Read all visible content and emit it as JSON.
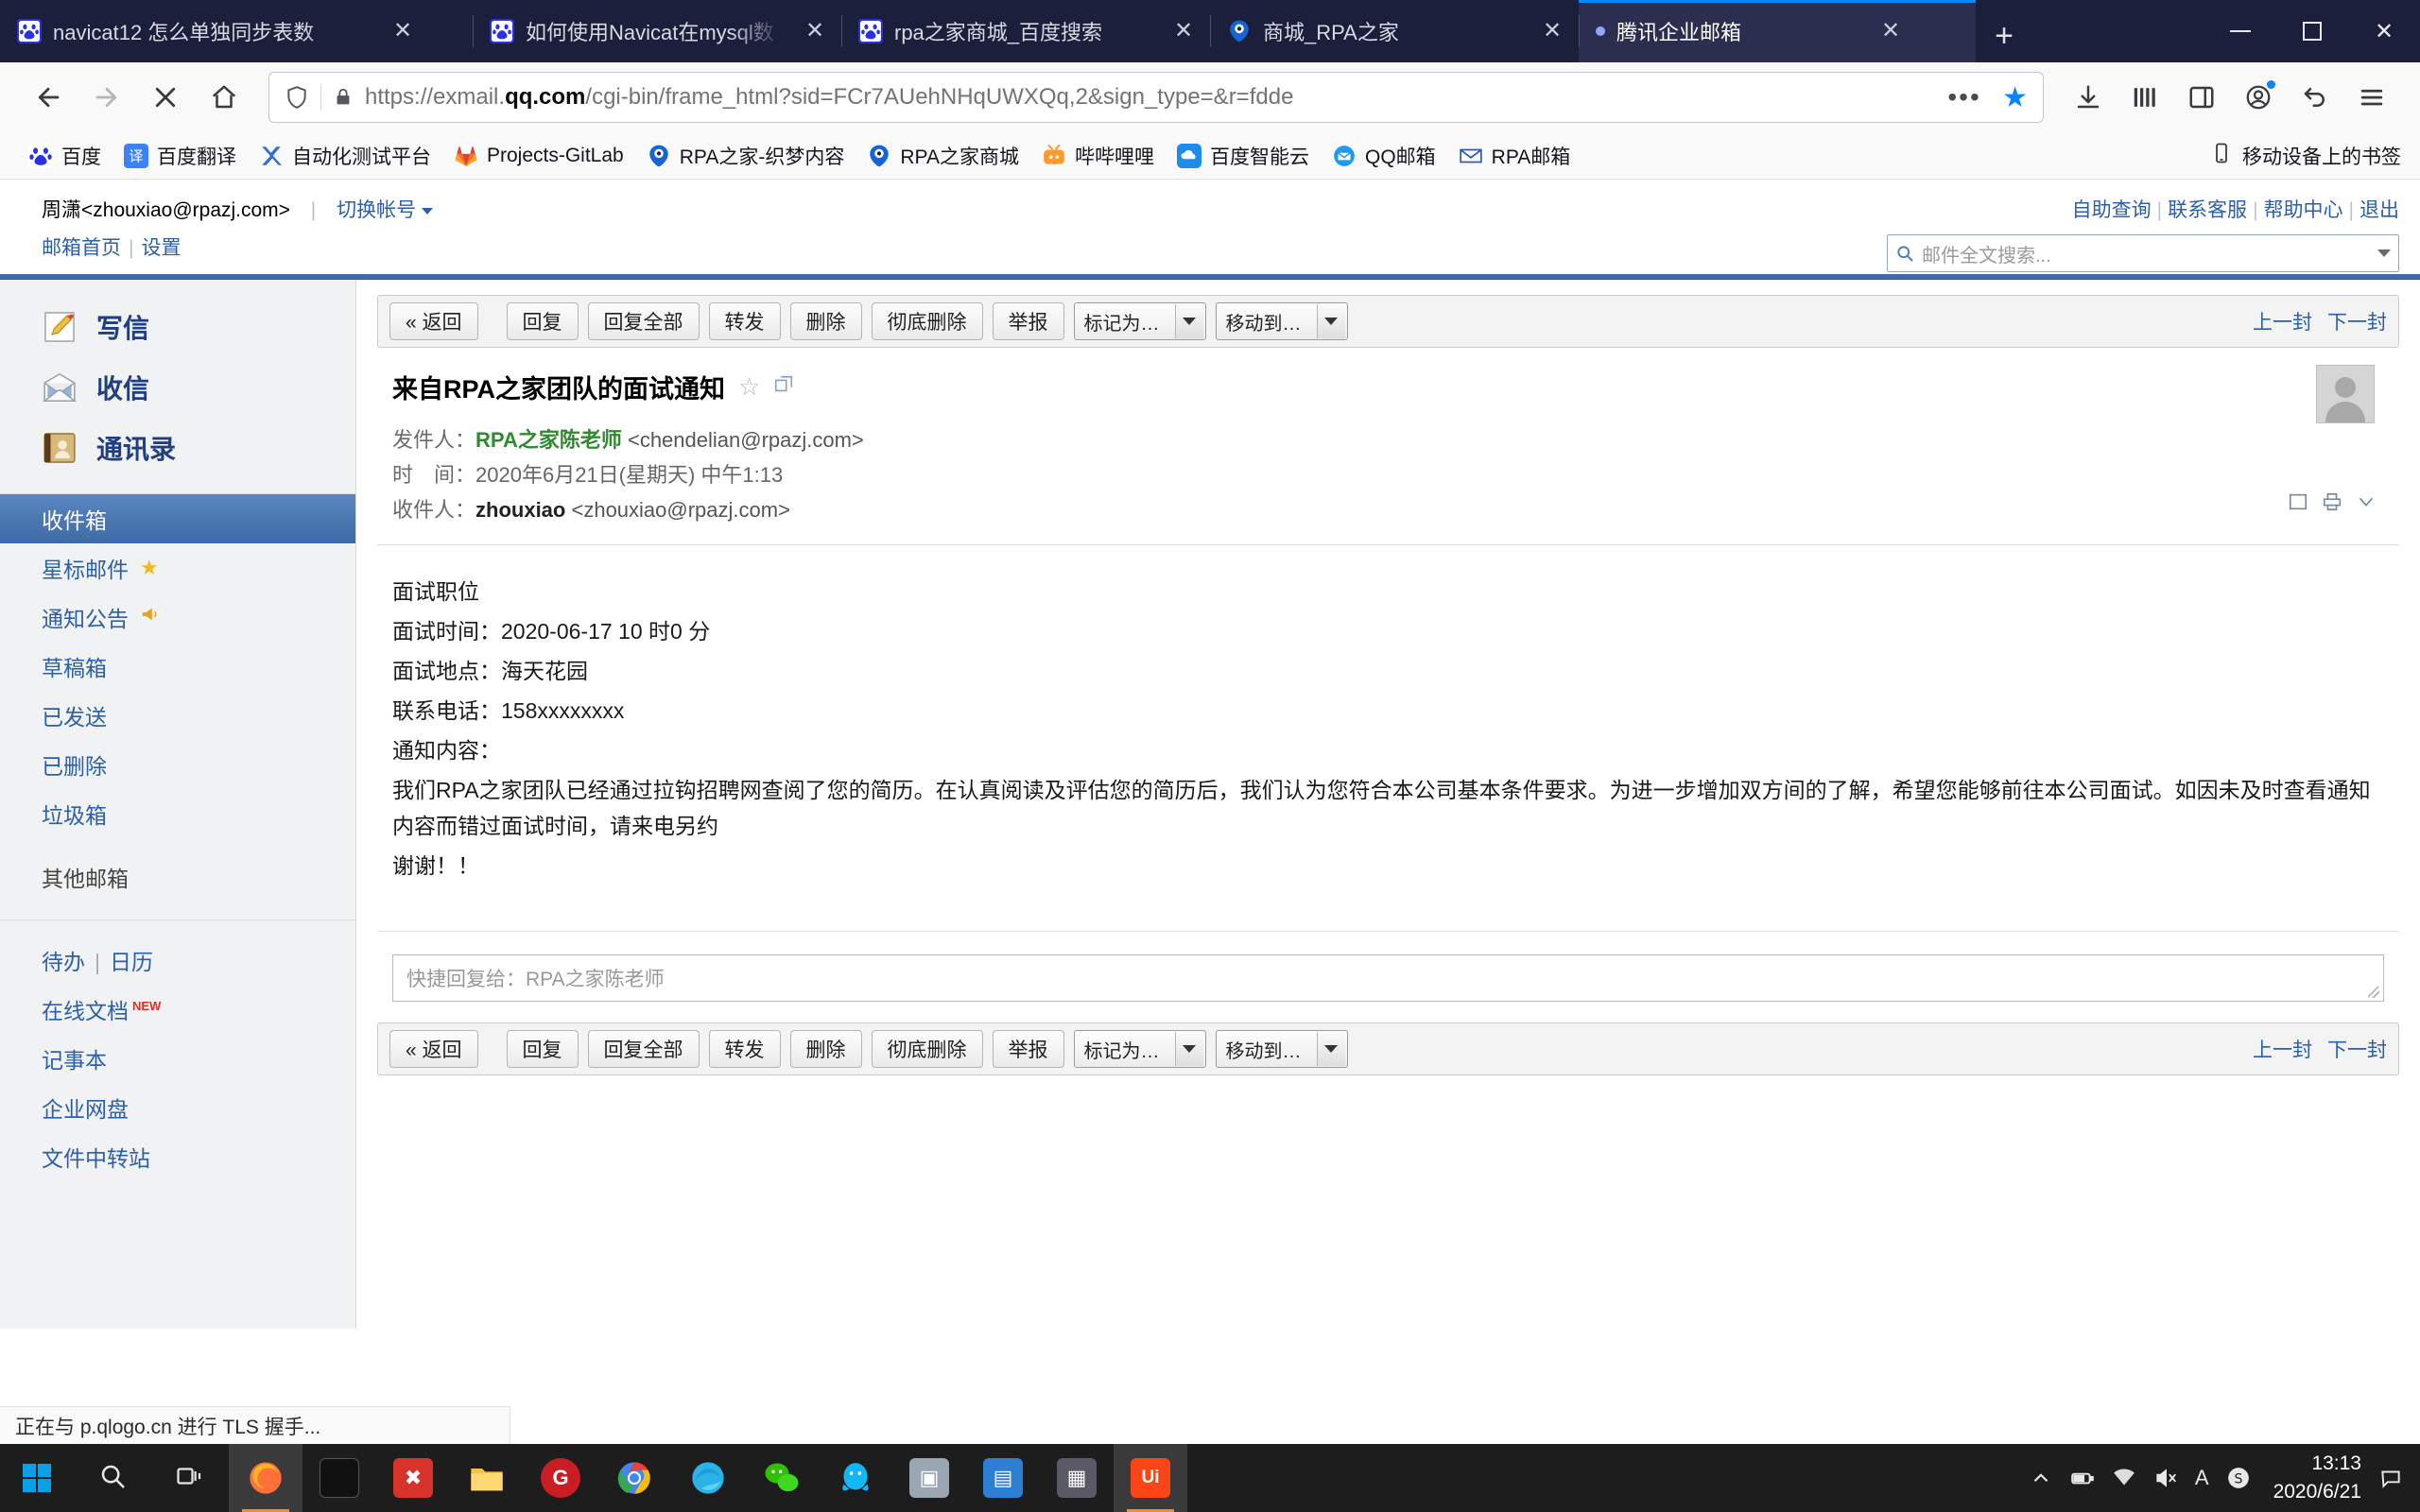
{
  "browser": {
    "tabs": [
      {
        "title": "navicat12 怎么单独同步表数",
        "favicon": "baidu-icon",
        "active": false,
        "pending": false
      },
      {
        "title": "如何使用Navicat在mysql数",
        "favicon": "baidu-icon",
        "active": false,
        "pending": false
      },
      {
        "title": "rpa之家商城_百度搜索",
        "favicon": "baidu-icon",
        "active": false,
        "pending": false
      },
      {
        "title": "商城_RPA之家",
        "favicon": "rpa-icon",
        "active": false,
        "pending": false
      },
      {
        "title": "腾讯企业邮箱",
        "favicon": "loading-dot-icon",
        "active": true,
        "pending": true
      }
    ],
    "new_tab_label": "+",
    "window_controls": {
      "minimize": "—",
      "maximize": "▢",
      "close": "✕"
    },
    "url": {
      "scheme": "https://exmail.",
      "domain": "qq.com",
      "path": "/cgi-bin/frame_html?sid=FCr7AUehNHqUWXQq,2&sign_type=&r=fdde"
    },
    "url_actions": {
      "ellipsis": "•••",
      "bookmark_star": "★"
    },
    "bookmarks": [
      {
        "label": "百度",
        "icon": "baidu-icon"
      },
      {
        "label": "百度翻译",
        "icon": "translate-icon"
      },
      {
        "label": "自动化测试平台",
        "icon": "x-icon"
      },
      {
        "label": "Projects-GitLab",
        "icon": "gitlab-icon"
      },
      {
        "label": "RPA之家-织梦内容",
        "icon": "rpa-icon"
      },
      {
        "label": "RPA之家商城",
        "icon": "rpa-icon"
      },
      {
        "label": "哔哔哩哩",
        "icon": "bilibili-icon"
      },
      {
        "label": "百度智能云",
        "icon": "baiduyun-icon"
      },
      {
        "label": "QQ邮箱",
        "icon": "qqmail-icon"
      },
      {
        "label": "RPA邮箱",
        "icon": "mail-icon"
      }
    ],
    "bookmarks_right": {
      "label": "移动设备上的书签",
      "icon": "mobile-icon"
    },
    "status_bar_text": "正在与 p.qlogo.cn 进行 TLS 握手..."
  },
  "mail": {
    "top_links": [
      "自助查询",
      "联系客服",
      "帮助中心",
      "退出"
    ],
    "account": {
      "name": "周潇<zhouxiao@rpazj.com>",
      "switch_label": "切换帐号"
    },
    "sub_links": [
      "邮箱首页",
      "设置"
    ],
    "search": {
      "placeholder": "邮件全文搜索...",
      "icon": "search-icon"
    },
    "sidebar": {
      "main_items": [
        {
          "label": "写信",
          "icon": "compose-icon"
        },
        {
          "label": "收信",
          "icon": "receive-icon"
        },
        {
          "label": "通讯录",
          "icon": "contacts-icon"
        }
      ],
      "folders": [
        {
          "label": "收件箱",
          "selected": true,
          "badge": ""
        },
        {
          "label": "星标邮件",
          "selected": false,
          "badge": "star-icon"
        },
        {
          "label": "通知公告",
          "selected": false,
          "badge": "horn-icon"
        },
        {
          "label": "草稿箱",
          "selected": false,
          "badge": ""
        },
        {
          "label": "已发送",
          "selected": false,
          "badge": ""
        },
        {
          "label": "已删除",
          "selected": false,
          "badge": ""
        },
        {
          "label": "垃圾箱",
          "selected": false,
          "badge": ""
        }
      ],
      "group_title": "其他邮箱",
      "links_row1": [
        "待办",
        "日历"
      ],
      "links": [
        {
          "label": "在线文档",
          "sup": "NEW"
        },
        {
          "label": "记事本",
          "sup": ""
        },
        {
          "label": "企业网盘",
          "sup": ""
        },
        {
          "label": "文件中转站",
          "sup": ""
        }
      ]
    },
    "toolbar": {
      "back": "« 返回",
      "reply": "回复",
      "reply_all": "回复全部",
      "forward": "转发",
      "delete": "删除",
      "delete_forever": "彻底删除",
      "report": "举报",
      "mark_as": "标记为…",
      "move_to": "移动到…",
      "prev": "上一封",
      "next": "下一封"
    },
    "message": {
      "subject": "来自RPA之家团队的面试通知",
      "star_icon": "star-outline-icon",
      "window_icon": "new-window-icon",
      "from_label": "发件人：",
      "from_name": "RPA之家陈老师",
      "from_address": "<chendelian@rpazj.com>",
      "date_label": "时　间：",
      "date_value": "2020年6月21日(星期天) 中午1:13",
      "to_label": "收件人：",
      "to_name": "zhouxiao",
      "to_address": "<zhouxiao@rpazj.com>",
      "body_lines": [
        "面试职位",
        "面试时间：2020-06-17 10 时0 分",
        "面试地点：海天花园",
        "联系电话：158xxxxxxxx",
        "通知内容："
      ],
      "body_paragraph": "我们RPA之家团队已经通过拉钩招聘网查阅了您的简历。在认真阅读及评估您的简历后，我们认为您符合本公司基本条件要求。为进一步增加双方间的了解，希望您能够前往本公司面试。如因未及时查看通知内容而错过面试时间，请来电另约",
      "body_closing": "谢谢！！"
    },
    "quick_reply": {
      "placeholder": "快捷回复给：RPA之家陈老师"
    }
  },
  "taskbar": {
    "start_label": "start-icon",
    "search_label": "search-icon",
    "taskview_label": "taskview-icon",
    "apps": [
      {
        "name": "firefox",
        "glyph": "🦊",
        "color": "#e8620a",
        "active": true
      },
      {
        "name": "terminal",
        "glyph": "▮",
        "color": "#111111",
        "active": false
      },
      {
        "name": "xmind",
        "glyph": "✖",
        "color": "#e03030",
        "active": false
      },
      {
        "name": "explorer",
        "glyph": "📁",
        "color": "#f5b932",
        "active": false
      },
      {
        "name": "gitee",
        "glyph": "G",
        "color": "#c71d23",
        "active": false
      },
      {
        "name": "chrome",
        "glyph": "◎",
        "color": "#4285f4",
        "active": false
      },
      {
        "name": "edge",
        "glyph": "◐",
        "color": "#23a9dd",
        "active": false
      },
      {
        "name": "wechat",
        "glyph": "💬",
        "color": "#2dc100",
        "active": false
      },
      {
        "name": "qq",
        "glyph": "🐧",
        "color": "#12b7f5",
        "active": false
      },
      {
        "name": "vmware",
        "glyph": "▣",
        "color": "#8f9aa6",
        "active": false
      },
      {
        "name": "notes",
        "glyph": "▤",
        "color": "#2d7fd3",
        "active": false
      },
      {
        "name": "pycharm",
        "glyph": "▦",
        "color": "#5c5c66",
        "active": false
      },
      {
        "name": "uipath",
        "glyph": "Ui",
        "color": "#fa4616",
        "active": true
      }
    ],
    "tray_icons": [
      "chevron-up-icon",
      "battery-icon",
      "wifi-icon",
      "volume-icon",
      "ime-icon",
      "sogou-icon",
      "notification-icon"
    ],
    "clock": {
      "time": "13:13",
      "date": "2020/6/21"
    }
  }
}
